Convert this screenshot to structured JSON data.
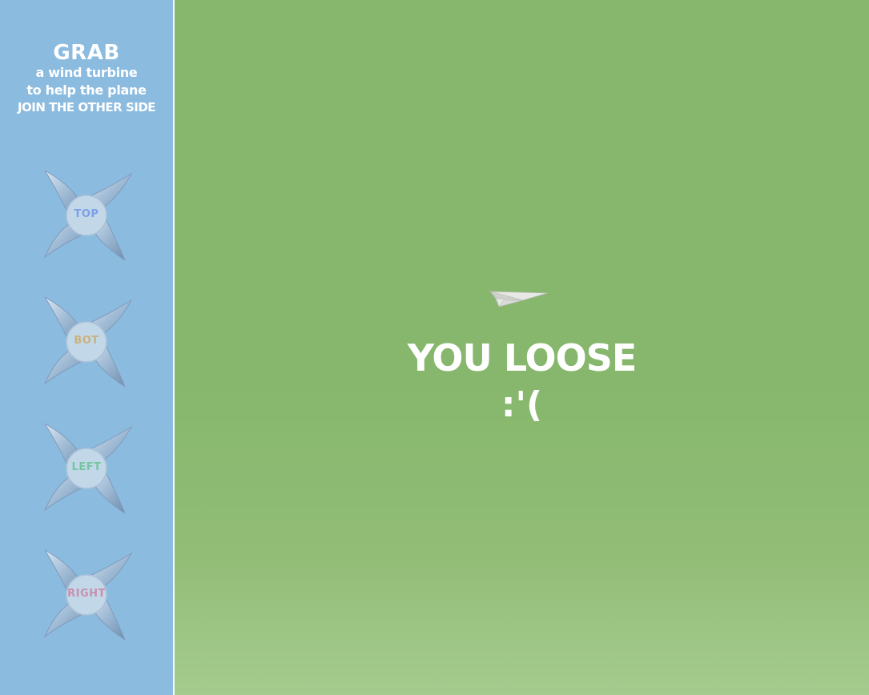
{
  "sidebar": {
    "title": {
      "grab": "GRAB",
      "line1": "a wind turbine",
      "line2": "to help the plane",
      "line3": "JOIN THE OTHER SIDE"
    },
    "turbines": [
      {
        "label": "TOP",
        "label_color": "#7d9fe8",
        "icon": "wind-turbine-icon"
      },
      {
        "label": "BOT",
        "label_color": "#c9b27e",
        "icon": "wind-turbine-icon"
      },
      {
        "label": "LEFT",
        "label_color": "#76c6a2",
        "icon": "wind-turbine-icon"
      },
      {
        "label": "RIGHT",
        "label_color": "#cc8fae",
        "icon": "wind-turbine-icon"
      }
    ]
  },
  "game": {
    "plane_icon": "paper-plane-icon",
    "result_title": "YOU LOOSE",
    "result_face": ":'("
  },
  "colors": {
    "sidebar_bg": "#8bbbdf",
    "game_bg": "#86b76c",
    "text": "#ffffff"
  }
}
